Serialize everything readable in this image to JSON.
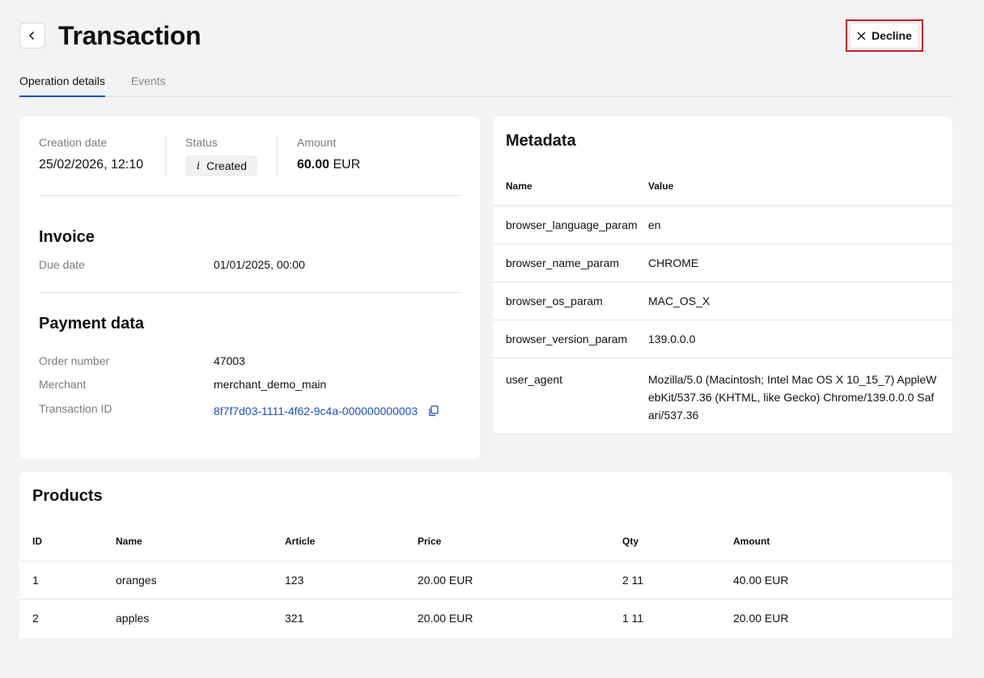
{
  "header": {
    "title": "Transaction",
    "decline_label": "Decline"
  },
  "tabs": [
    {
      "label": "Operation details",
      "active": true
    },
    {
      "label": "Events",
      "active": false
    }
  ],
  "summary": {
    "creation_label": "Creation date",
    "creation_value": "25/02/2026, 12:10",
    "status_label": "Status",
    "status_value": "Created",
    "amount_label": "Amount",
    "amount_value": "60.00",
    "amount_currency": "EUR"
  },
  "invoice": {
    "title": "Invoice",
    "due_label": "Due date",
    "due_value": "01/01/2025, 00:00"
  },
  "payment": {
    "title": "Payment data",
    "order_label": "Order number",
    "order_value": "47003",
    "merchant_label": "Merchant",
    "merchant_value": "merchant_demo_main",
    "txid_label": "Transaction ID",
    "txid_value": "8f7f7d03-1111-4f62-9c4a-000000000003"
  },
  "metadata": {
    "title": "Metadata",
    "col_name": "Name",
    "col_value": "Value",
    "rows": [
      {
        "name": "browser_language_param",
        "value": "en"
      },
      {
        "name": "browser_name_param",
        "value": "CHROME"
      },
      {
        "name": "browser_os_param",
        "value": "MAC_OS_X"
      },
      {
        "name": "browser_version_param",
        "value": "139.0.0.0"
      },
      {
        "name": "user_agent",
        "value": "Mozilla/5.0 (Macintosh; Intel Mac OS X 10_15_7) AppleWebKit/537.36 (KHTML, like Gecko) Chrome/139.0.0.0 Safari/537.36"
      }
    ]
  },
  "products": {
    "title": "Products",
    "columns": [
      "ID",
      "Name",
      "Article",
      "Price",
      "Qty",
      "Amount"
    ],
    "rows": [
      [
        "1",
        "oranges",
        "123",
        "20.00 EUR",
        "2 11",
        "40.00 EUR"
      ],
      [
        "2",
        "apples",
        "321",
        "20.00 EUR",
        "1 11",
        "20.00 EUR"
      ]
    ]
  },
  "colors": {
    "accent": "#1d4fc2",
    "highlight_border": "#d3151b",
    "background": "#f3f3f5"
  },
  "icons": {
    "back": "chevron-left-icon",
    "decline": "close-icon",
    "status": "info-icon",
    "copy": "copy-icon"
  }
}
